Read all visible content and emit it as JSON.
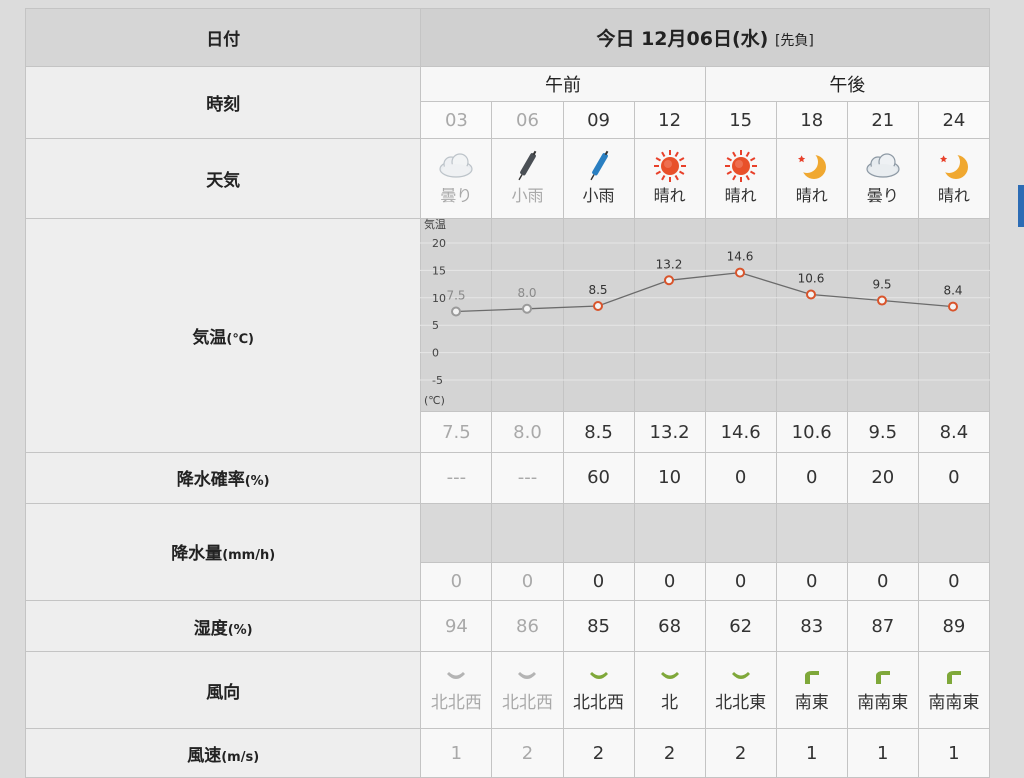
{
  "labels": {
    "date": "日付",
    "time": "時刻",
    "weather": "天気",
    "temp": "気温",
    "temp_unit": "(℃)",
    "pop": "降水確率",
    "pop_unit": "(%)",
    "rain": "降水量",
    "rain_unit": "(mm/h)",
    "humidity": "湿度",
    "humidity_unit": "(%)",
    "wind_dir": "風向",
    "wind_speed": "風速",
    "wind_speed_unit": "(m/s)"
  },
  "date": {
    "text": "今日 12月06日(水)",
    "tag": "[先負]"
  },
  "halves": {
    "am": "午前",
    "pm": "午後"
  },
  "hours": [
    "03",
    "06",
    "09",
    "12",
    "15",
    "18",
    "21",
    "24"
  ],
  "weather": [
    {
      "icon": "cloud-icon",
      "text": "曇り"
    },
    {
      "icon": "umbrella-icon",
      "text": "小雨"
    },
    {
      "icon": "umbrella-icon",
      "text": "小雨"
    },
    {
      "icon": "sun-icon",
      "text": "晴れ"
    },
    {
      "icon": "sun-icon",
      "text": "晴れ"
    },
    {
      "icon": "moon-icon",
      "text": "晴れ"
    },
    {
      "icon": "cloud-icon",
      "text": "曇り"
    },
    {
      "icon": "moon-icon",
      "text": "晴れ"
    }
  ],
  "graph": {
    "axis_title": "気温",
    "axis_unit": "(℃)",
    "ticks": [
      "20",
      "15",
      "10",
      "5",
      "0",
      "-5"
    ]
  },
  "temp": [
    "7.5",
    "8.0",
    "8.5",
    "13.2",
    "14.6",
    "10.6",
    "9.5",
    "8.4"
  ],
  "pop": [
    "---",
    "---",
    "60",
    "10",
    "0",
    "0",
    "20",
    "0"
  ],
  "rain": [
    "0",
    "0",
    "0",
    "0",
    "0",
    "0",
    "0",
    "0"
  ],
  "humidity": [
    "94",
    "86",
    "85",
    "68",
    "62",
    "83",
    "87",
    "89"
  ],
  "wind_dir": [
    "北北西",
    "北北西",
    "北北西",
    "北",
    "北北東",
    "南東",
    "南南東",
    "南南東"
  ],
  "wind_speed": [
    "1",
    "2",
    "2",
    "2",
    "2",
    "1",
    "1",
    "1"
  ],
  "past_columns": 2,
  "colors": {
    "line": "#6b6b6b",
    "marker": "#d9542b",
    "past_marker": "#9a9a9a",
    "grid": "#e6e6e6",
    "plot_bg": "#d4d4d4",
    "icon_green": "#7fa83a",
    "sun": "#e8402a"
  },
  "chart_data": {
    "type": "line",
    "x": [
      "03",
      "06",
      "09",
      "12",
      "15",
      "18",
      "21",
      "24"
    ],
    "series": [
      {
        "values": [
          7.5,
          8.0,
          8.5,
          13.2,
          14.6,
          10.6,
          9.5,
          8.4
        ]
      }
    ],
    "ylabel": "気温 (℃)",
    "ylim": [
      -5,
      20
    ],
    "yticks": [
      20,
      15,
      10,
      5,
      0,
      -5
    ],
    "grid": true
  }
}
